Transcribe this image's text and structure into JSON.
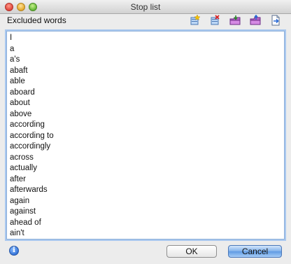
{
  "window": {
    "title": "Stop list"
  },
  "header": {
    "label": "Excluded words"
  },
  "toolbar": {
    "icons": [
      "add-icon",
      "remove-icon",
      "import-icon",
      "export-icon",
      "load-icon"
    ]
  },
  "list": {
    "items": [
      "I",
      "a",
      "a's",
      "abaft",
      "able",
      "aboard",
      "about",
      "above",
      "according",
      "according to",
      "accordingly",
      "across",
      "actually",
      "after",
      "afterwards",
      "again",
      "against",
      "ahead of",
      "ain't"
    ]
  },
  "footer": {
    "ok_label": "OK",
    "cancel_label": "Cancel",
    "info_glyph": "i"
  },
  "colors": {
    "accent": "#5e9ae3",
    "focus_ring": "#a9c8ef"
  }
}
